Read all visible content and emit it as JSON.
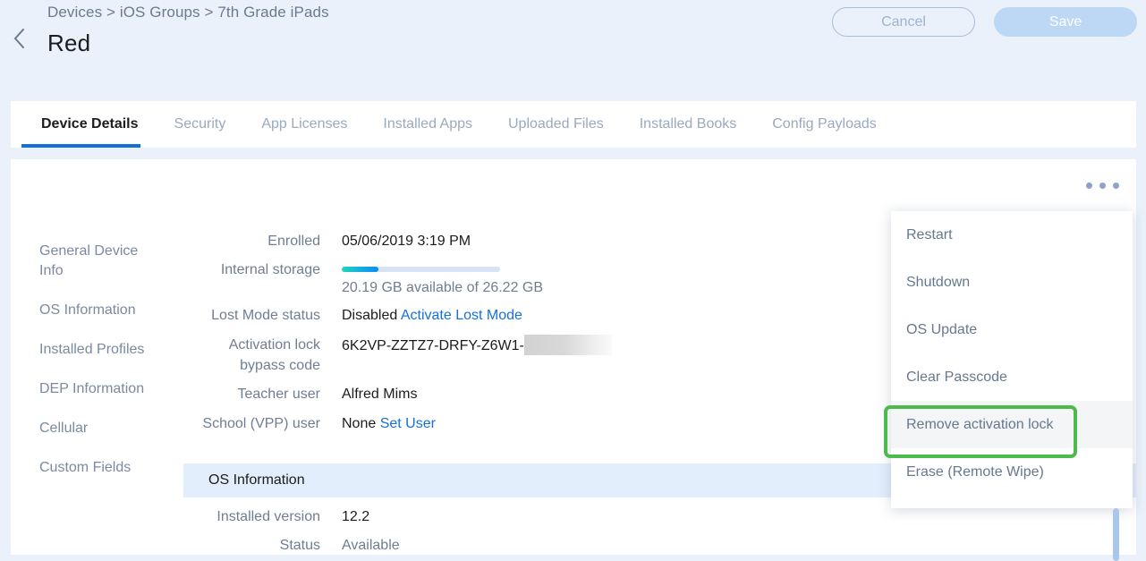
{
  "header": {
    "breadcrumb": "Devices > iOS Groups > 7th Grade iPads",
    "title": "Red",
    "back_icon": "chevron-left-icon",
    "cancel_label": "Cancel",
    "save_label": "Save",
    "accent_color": "#1471d8",
    "background_color": "#eaf1fa"
  },
  "tabs": [
    {
      "label": "Device Details",
      "active": true
    },
    {
      "label": "Security",
      "active": false
    },
    {
      "label": "App Licenses",
      "active": false
    },
    {
      "label": "Installed Apps",
      "active": false
    },
    {
      "label": "Uploaded Files",
      "active": false
    },
    {
      "label": "Installed Books",
      "active": false
    },
    {
      "label": "Config Payloads",
      "active": false
    }
  ],
  "sidebar": {
    "items": [
      {
        "label": "General Device Info"
      },
      {
        "label": "OS Information"
      },
      {
        "label": "Installed Profiles"
      },
      {
        "label": "DEP Information"
      },
      {
        "label": "Cellular"
      },
      {
        "label": "Custom Fields"
      }
    ]
  },
  "kebab_icon": "ellipsis-horizontal-icon",
  "details": {
    "enrolled": {
      "label": "Enrolled",
      "value": "05/06/2019 3:19 PM"
    },
    "internal_storage": {
      "label": "Internal storage",
      "summary": "20.19 GB available of 26.22 GB",
      "available_gb": 20.19,
      "total_gb": 26.22,
      "used_percent": 23
    },
    "lost_mode": {
      "label": "Lost Mode status",
      "value": "Disabled",
      "action_label": "Activate Lost Mode"
    },
    "activation_lock": {
      "label_line1": "Activation lock",
      "label_line2": "bypass code",
      "value": "6K2VP-ZZTZ7-DRFY-Z6W1-",
      "redacted": true
    },
    "teacher_user": {
      "label": "Teacher user",
      "value": "Alfred Mims"
    },
    "school_user": {
      "label": "School (VPP) user",
      "value": "None",
      "action_label": "Set User"
    }
  },
  "os_section": {
    "title": "OS Information",
    "rows": [
      {
        "label": "Installed version",
        "value": "12.2"
      },
      {
        "label": "Status",
        "value": "Available"
      }
    ]
  },
  "menu": {
    "items": [
      {
        "label": "Restart",
        "hovered": false
      },
      {
        "label": "Shutdown",
        "hovered": false
      },
      {
        "label": "OS Update",
        "hovered": false
      },
      {
        "label": "Clear Passcode",
        "hovered": false
      },
      {
        "label": "Remove activation lock",
        "hovered": true
      },
      {
        "label": "Erase (Remote Wipe)",
        "hovered": false
      }
    ],
    "highlight_color": "#4cbb4c"
  }
}
